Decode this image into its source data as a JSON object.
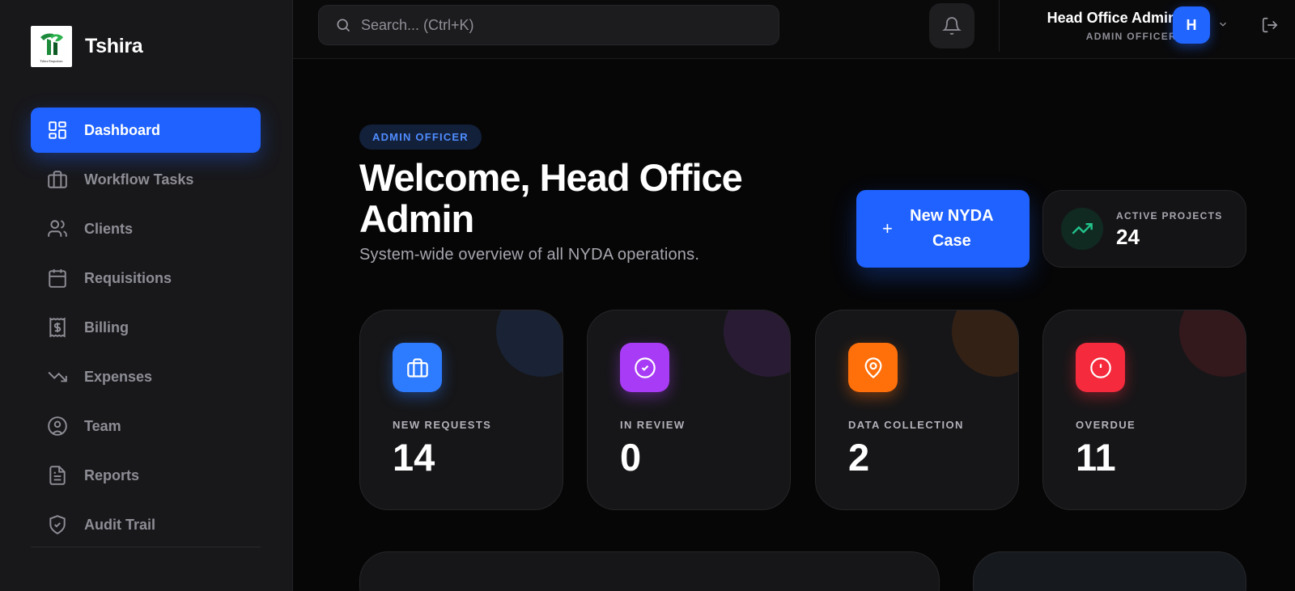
{
  "brand": {
    "name": "Tshira",
    "logo_text": "Tshira Emporium"
  },
  "sidebar": {
    "items": [
      {
        "label": "Dashboard",
        "icon": "grid-icon",
        "active": true
      },
      {
        "label": "Workflow Tasks",
        "icon": "briefcase-icon"
      },
      {
        "label": "Clients",
        "icon": "users-icon"
      },
      {
        "label": "Requisitions",
        "icon": "calendar-icon"
      },
      {
        "label": "Billing",
        "icon": "receipt-dollar-icon"
      },
      {
        "label": "Expenses",
        "icon": "trending-down-icon"
      },
      {
        "label": "Team",
        "icon": "user-circle-icon"
      },
      {
        "label": "Reports",
        "icon": "file-text-icon"
      },
      {
        "label": "Audit Trail",
        "icon": "shield-check-icon"
      }
    ]
  },
  "header": {
    "search_placeholder": "Search... (Ctrl+K)",
    "user_name": "Head Office Admin",
    "user_role": "ADMIN OFFICER",
    "avatar_initial": "H"
  },
  "main": {
    "role_badge": "ADMIN OFFICER",
    "welcome": "Welcome, Head Office Admin",
    "subtitle": "System-wide overview of all NYDA operations.",
    "new_case_label": "New NYDA Case",
    "active_projects": {
      "label": "ACTIVE PROJECTS",
      "value": "24"
    },
    "stats": [
      {
        "label": "NEW REQUESTS",
        "value": "14",
        "icon": "briefcase-icon",
        "color": "#2d7bff"
      },
      {
        "label": "IN REVIEW",
        "value": "0",
        "icon": "check-circle-icon",
        "color": "#a83bf5"
      },
      {
        "label": "DATA COLLECTION",
        "value": "2",
        "icon": "map-pin-icon",
        "color": "#ff6f0a"
      },
      {
        "label": "OVERDUE",
        "value": "11",
        "icon": "alert-circle-icon",
        "color": "#f52a3c"
      }
    ]
  },
  "colors": {
    "accent": "#1f62ff",
    "sidebar_bg": "#18181b",
    "page_bg": "#060607",
    "success": "#22c58b"
  }
}
